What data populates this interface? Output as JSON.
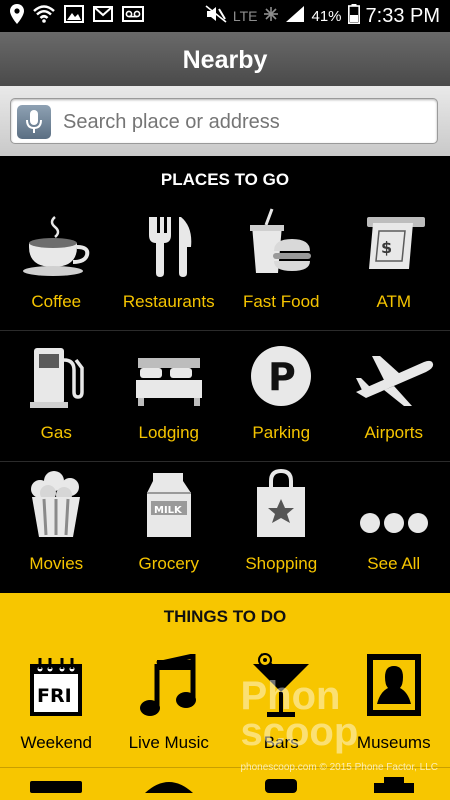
{
  "status_bar": {
    "left_icons": [
      "location-icon",
      "wifi-icon",
      "image-icon",
      "gmail-icon",
      "voicemail-icon"
    ],
    "right_icons": [
      "mute-icon",
      "lte-icon",
      "signal-icon",
      "battery-icon"
    ],
    "network": "LTE",
    "battery": "41%",
    "time": "7:33 PM"
  },
  "header": {
    "title": "Nearby"
  },
  "search": {
    "placeholder": "Search place or address",
    "mic_icon": "mic-icon"
  },
  "places": {
    "heading": "PLACES TO GO",
    "items": [
      {
        "label": "Coffee",
        "icon": "coffee-icon"
      },
      {
        "label": "Restaurants",
        "icon": "fork-knife-icon"
      },
      {
        "label": "Fast Food",
        "icon": "fast-food-icon"
      },
      {
        "label": "ATM",
        "icon": "atm-icon"
      },
      {
        "label": "Gas",
        "icon": "gas-pump-icon"
      },
      {
        "label": "Lodging",
        "icon": "bed-icon"
      },
      {
        "label": "Parking",
        "icon": "parking-icon"
      },
      {
        "label": "Airports",
        "icon": "airplane-icon"
      },
      {
        "label": "Movies",
        "icon": "popcorn-icon"
      },
      {
        "label": "Grocery",
        "icon": "milk-carton-icon"
      },
      {
        "label": "Shopping",
        "icon": "shopping-bag-icon"
      },
      {
        "label": "See All",
        "icon": "more-dots-icon"
      }
    ],
    "milk_text": "MILK"
  },
  "things": {
    "heading": "THINGS TO DO",
    "items": [
      {
        "label": "Weekend",
        "icon": "calendar-fri-icon",
        "icon_text": "FRI"
      },
      {
        "label": "Live Music",
        "icon": "music-note-icon"
      },
      {
        "label": "Bars",
        "icon": "cocktail-icon"
      },
      {
        "label": "Museums",
        "icon": "painting-icon"
      }
    ]
  },
  "watermark": {
    "line1": "Phon",
    "line2": "scoop",
    "small": "phonescoop.com © 2015 Phone Factor, LLC"
  },
  "colors": {
    "accent": "#f5c400",
    "yellow_bg": "#f7c600",
    "dark_bg": "#000000"
  }
}
